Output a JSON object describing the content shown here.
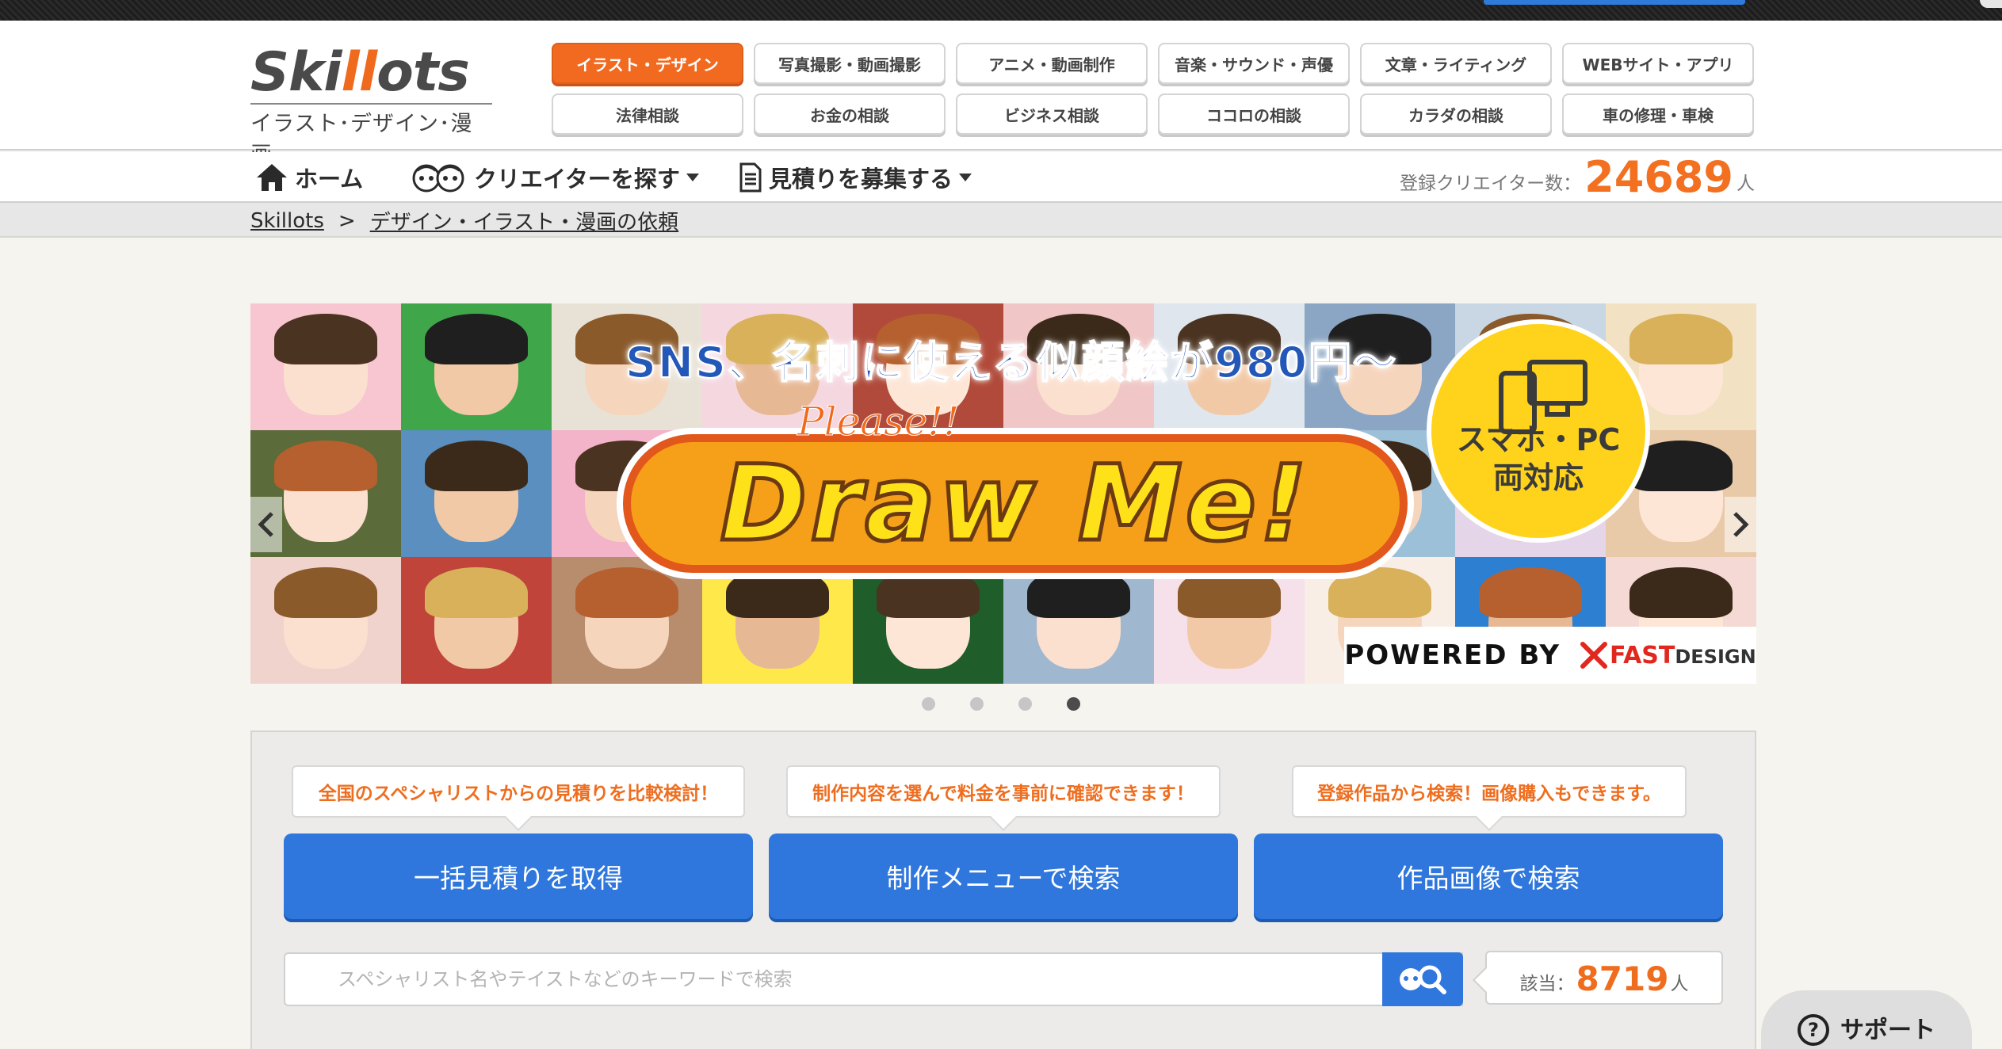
{
  "logo": {
    "word_a": "Ski",
    "word_b": "ll",
    "word_c": "ots",
    "subtitle": "イラスト･デザイン･漫画"
  },
  "categories": [
    {
      "label": "イラスト・デザイン",
      "active": true
    },
    {
      "label": "写真撮影・動画撮影"
    },
    {
      "label": "アニメ・動画制作"
    },
    {
      "label": "音楽・サウンド・声優"
    },
    {
      "label": "文章・ライティング"
    },
    {
      "label": "WEBサイト・アプリ"
    },
    {
      "label": "法律相談"
    },
    {
      "label": "お金の相談"
    },
    {
      "label": "ビジネス相談"
    },
    {
      "label": "ココロの相談"
    },
    {
      "label": "カラダの相談"
    },
    {
      "label": "車の修理・車検"
    }
  ],
  "nav": {
    "home": "ホーム",
    "find_creator": "クリエイターを探す",
    "post_estimate": "見積りを募集する",
    "count_label": "登録クリエイター数：",
    "count_value": "24689",
    "count_unit": "人"
  },
  "breadcrumb": {
    "root": "Skillots",
    "separator": ">",
    "current": "デザイン・イラスト・漫画の依頼"
  },
  "banner": {
    "headline": "SNS、名刺に使える似顔絵が980円～",
    "please": "Please!!",
    "drawme": "Draw Me!",
    "bubble_line1": "スマホ・PC",
    "bubble_line2": "両対応",
    "powered_by": "POWERED BY",
    "brand_a": "FAST",
    "brand_b": "DESIGN",
    "slide_count": 4,
    "active_slide": 4
  },
  "actions": {
    "tip1": "全国のスペシャリストからの見積りを比較検討！",
    "tip2": "制作内容を選んで料金を事前に確認できます！",
    "tip3": "登録作品から検索！画像購入もできます。",
    "btn1": "一括見積りを取得",
    "btn2": "制作メニューで検索",
    "btn3": "作品画像で検索"
  },
  "search": {
    "placeholder": "スペシャリスト名やテイストなどのキーワードで検索",
    "result_label": "該当：",
    "result_value": "8719",
    "result_unit": "人"
  },
  "support": {
    "label": "サポート"
  },
  "colors": {
    "accent": "#f26a20",
    "primary_blue": "#2f77dc",
    "background": "#f6f4ee"
  }
}
